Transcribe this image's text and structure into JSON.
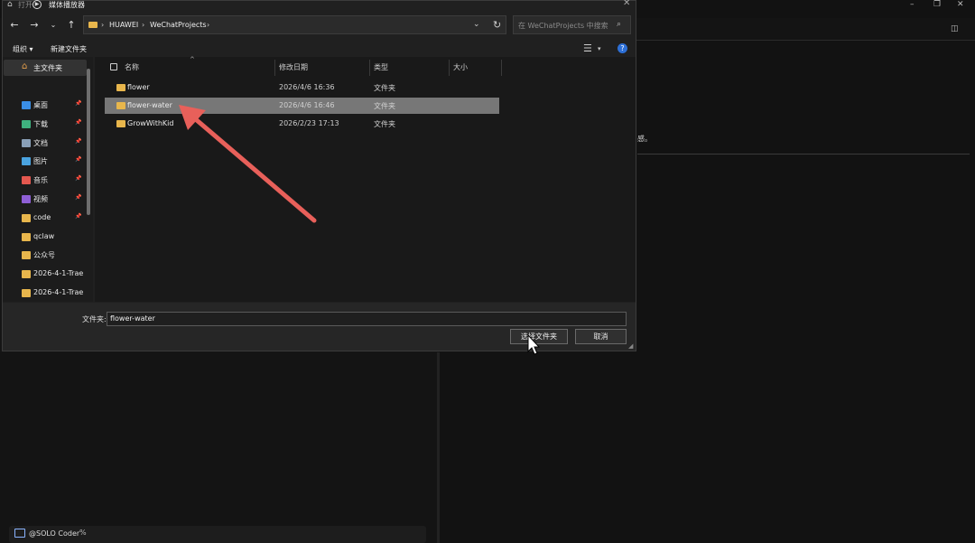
{
  "background": {
    "right_text_fragment": "感。",
    "status_label": "@SOLO Coder",
    "status_extra": "%"
  },
  "dialog": {
    "title_fragment": "打开",
    "title": "媒体播放器",
    "address": {
      "segments": [
        "HUAWEI",
        "WeChatProjects"
      ],
      "separator": "›"
    },
    "search_placeholder": "在 WeChatProjects 中搜索",
    "toolbar": {
      "organize": "组织 ▾",
      "new_folder": "新建文件夹"
    },
    "sidebar": {
      "home": "主文件夹",
      "items": [
        {
          "label": "桌面",
          "icon": "desktop-icon",
          "color": "#3a8ee6",
          "pinned": true
        },
        {
          "label": "下载",
          "icon": "download-icon",
          "color": "#3fb27f",
          "pinned": true
        },
        {
          "label": "文档",
          "icon": "document-icon",
          "color": "#8aa0b8",
          "pinned": true
        },
        {
          "label": "图片",
          "icon": "pictures-icon",
          "color": "#4aa3df",
          "pinned": true
        },
        {
          "label": "音乐",
          "icon": "music-icon",
          "color": "#e4584f",
          "pinned": true
        },
        {
          "label": "视频",
          "icon": "video-icon",
          "color": "#8e5fd6",
          "pinned": true
        },
        {
          "label": "code",
          "icon": "folder-icon",
          "color": "#e8b64c",
          "pinned": true
        },
        {
          "label": "qclaw",
          "icon": "folder-icon",
          "color": "#e8b64c",
          "pinned": false
        },
        {
          "label": "公众号",
          "icon": "folder-icon",
          "color": "#e8b64c",
          "pinned": false
        },
        {
          "label": "2026-4-1-Trae",
          "icon": "folder-icon",
          "color": "#e8b64c",
          "pinned": false
        },
        {
          "label": "2026-4-1-Trae",
          "icon": "folder-icon",
          "color": "#e8b64c",
          "pinned": false
        }
      ]
    },
    "columns": {
      "name": "名称",
      "date": "修改日期",
      "type": "类型",
      "size": "大小"
    },
    "files": [
      {
        "name": "flower",
        "date": "2026/4/6 16:36",
        "type": "文件夹",
        "selected": false
      },
      {
        "name": "flower-water",
        "date": "2026/4/6 16:46",
        "type": "文件夹",
        "selected": true
      },
      {
        "name": "GrowWithKid",
        "date": "2026/2/23 17:13",
        "type": "文件夹",
        "selected": false
      }
    ],
    "folder_label": "文件夹:",
    "folder_value": "flower-water",
    "select_button": "选择文件夹",
    "cancel_button": "取消"
  },
  "colors": {
    "accent_arrow": "#e8605a",
    "folder": "#e8b64c",
    "selected_row": "#777777"
  }
}
